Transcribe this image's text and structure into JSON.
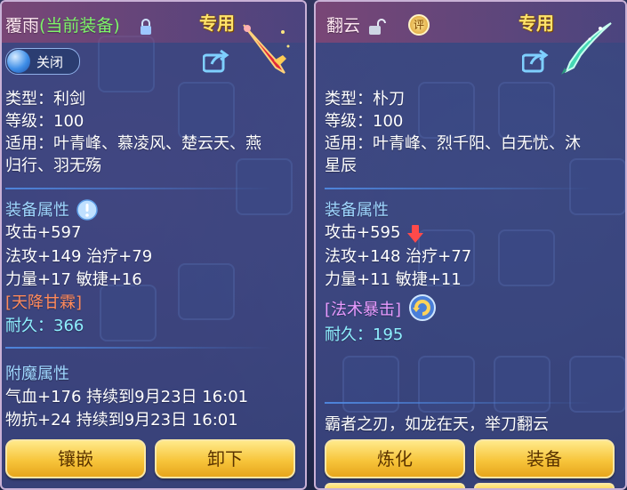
{
  "left_item": {
    "name": "覆雨",
    "equipped_tag": "(当前装备)",
    "exclusive_label": "专用",
    "toggle_label": "关闭",
    "type": "类型：利剑",
    "level": "等级：100",
    "usable_line1": "适用：叶青峰、慕凌风、楚云天、燕",
    "usable_line2": "归行、羽无殇",
    "attr_title": "装备属性",
    "attack": "攻击+597",
    "magic_line": "法攻+149 治疗+79",
    "str_line": "力量+17 敏捷+16",
    "special": "[天降甘霖]",
    "durability_label": "耐久：",
    "durability_value": "366",
    "enchant_title": "附魔属性",
    "enchant1": "气血+176 持续到9月23日 16:01",
    "enchant2": "物抗+24 持续到9月23日 16:01",
    "btn_inlay": "镶嵌",
    "btn_unequip": "卸下"
  },
  "right_item": {
    "name": "翻云",
    "badge": "评",
    "exclusive_label": "专用",
    "type": "类型：朴刀",
    "level": "等级：100",
    "usable_line1": "适用：叶青峰、烈千阳、白无忧、沐",
    "usable_line2": "星辰",
    "attr_title": "装备属性",
    "attack": "攻击+595",
    "magic_line": "法攻+148 治疗+77",
    "str_line": "力量+11 敏捷+11",
    "special": "[法术暴击]",
    "durability_label": "耐久：",
    "durability_value": "195",
    "description": "霸者之刃，如龙在天，举刀翻云",
    "btn_refine": "炼化",
    "btn_equip": "装备"
  }
}
